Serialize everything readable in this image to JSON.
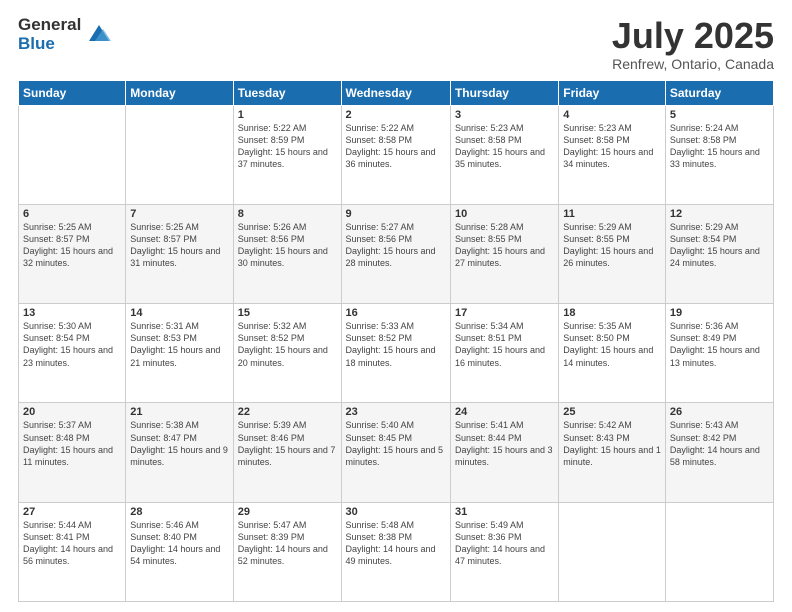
{
  "header": {
    "logo_general": "General",
    "logo_blue": "Blue",
    "title": "July 2025",
    "location": "Renfrew, Ontario, Canada"
  },
  "days_of_week": [
    "Sunday",
    "Monday",
    "Tuesday",
    "Wednesday",
    "Thursday",
    "Friday",
    "Saturday"
  ],
  "weeks": [
    [
      {
        "day": "",
        "info": ""
      },
      {
        "day": "",
        "info": ""
      },
      {
        "day": "1",
        "info": "Sunrise: 5:22 AM\nSunset: 8:59 PM\nDaylight: 15 hours and 37 minutes."
      },
      {
        "day": "2",
        "info": "Sunrise: 5:22 AM\nSunset: 8:58 PM\nDaylight: 15 hours and 36 minutes."
      },
      {
        "day": "3",
        "info": "Sunrise: 5:23 AM\nSunset: 8:58 PM\nDaylight: 15 hours and 35 minutes."
      },
      {
        "day": "4",
        "info": "Sunrise: 5:23 AM\nSunset: 8:58 PM\nDaylight: 15 hours and 34 minutes."
      },
      {
        "day": "5",
        "info": "Sunrise: 5:24 AM\nSunset: 8:58 PM\nDaylight: 15 hours and 33 minutes."
      }
    ],
    [
      {
        "day": "6",
        "info": "Sunrise: 5:25 AM\nSunset: 8:57 PM\nDaylight: 15 hours and 32 minutes."
      },
      {
        "day": "7",
        "info": "Sunrise: 5:25 AM\nSunset: 8:57 PM\nDaylight: 15 hours and 31 minutes."
      },
      {
        "day": "8",
        "info": "Sunrise: 5:26 AM\nSunset: 8:56 PM\nDaylight: 15 hours and 30 minutes."
      },
      {
        "day": "9",
        "info": "Sunrise: 5:27 AM\nSunset: 8:56 PM\nDaylight: 15 hours and 28 minutes."
      },
      {
        "day": "10",
        "info": "Sunrise: 5:28 AM\nSunset: 8:55 PM\nDaylight: 15 hours and 27 minutes."
      },
      {
        "day": "11",
        "info": "Sunrise: 5:29 AM\nSunset: 8:55 PM\nDaylight: 15 hours and 26 minutes."
      },
      {
        "day": "12",
        "info": "Sunrise: 5:29 AM\nSunset: 8:54 PM\nDaylight: 15 hours and 24 minutes."
      }
    ],
    [
      {
        "day": "13",
        "info": "Sunrise: 5:30 AM\nSunset: 8:54 PM\nDaylight: 15 hours and 23 minutes."
      },
      {
        "day": "14",
        "info": "Sunrise: 5:31 AM\nSunset: 8:53 PM\nDaylight: 15 hours and 21 minutes."
      },
      {
        "day": "15",
        "info": "Sunrise: 5:32 AM\nSunset: 8:52 PM\nDaylight: 15 hours and 20 minutes."
      },
      {
        "day": "16",
        "info": "Sunrise: 5:33 AM\nSunset: 8:52 PM\nDaylight: 15 hours and 18 minutes."
      },
      {
        "day": "17",
        "info": "Sunrise: 5:34 AM\nSunset: 8:51 PM\nDaylight: 15 hours and 16 minutes."
      },
      {
        "day": "18",
        "info": "Sunrise: 5:35 AM\nSunset: 8:50 PM\nDaylight: 15 hours and 14 minutes."
      },
      {
        "day": "19",
        "info": "Sunrise: 5:36 AM\nSunset: 8:49 PM\nDaylight: 15 hours and 13 minutes."
      }
    ],
    [
      {
        "day": "20",
        "info": "Sunrise: 5:37 AM\nSunset: 8:48 PM\nDaylight: 15 hours and 11 minutes."
      },
      {
        "day": "21",
        "info": "Sunrise: 5:38 AM\nSunset: 8:47 PM\nDaylight: 15 hours and 9 minutes."
      },
      {
        "day": "22",
        "info": "Sunrise: 5:39 AM\nSunset: 8:46 PM\nDaylight: 15 hours and 7 minutes."
      },
      {
        "day": "23",
        "info": "Sunrise: 5:40 AM\nSunset: 8:45 PM\nDaylight: 15 hours and 5 minutes."
      },
      {
        "day": "24",
        "info": "Sunrise: 5:41 AM\nSunset: 8:44 PM\nDaylight: 15 hours and 3 minutes."
      },
      {
        "day": "25",
        "info": "Sunrise: 5:42 AM\nSunset: 8:43 PM\nDaylight: 15 hours and 1 minute."
      },
      {
        "day": "26",
        "info": "Sunrise: 5:43 AM\nSunset: 8:42 PM\nDaylight: 14 hours and 58 minutes."
      }
    ],
    [
      {
        "day": "27",
        "info": "Sunrise: 5:44 AM\nSunset: 8:41 PM\nDaylight: 14 hours and 56 minutes."
      },
      {
        "day": "28",
        "info": "Sunrise: 5:46 AM\nSunset: 8:40 PM\nDaylight: 14 hours and 54 minutes."
      },
      {
        "day": "29",
        "info": "Sunrise: 5:47 AM\nSunset: 8:39 PM\nDaylight: 14 hours and 52 minutes."
      },
      {
        "day": "30",
        "info": "Sunrise: 5:48 AM\nSunset: 8:38 PM\nDaylight: 14 hours and 49 minutes."
      },
      {
        "day": "31",
        "info": "Sunrise: 5:49 AM\nSunset: 8:36 PM\nDaylight: 14 hours and 47 minutes."
      },
      {
        "day": "",
        "info": ""
      },
      {
        "day": "",
        "info": ""
      }
    ]
  ]
}
